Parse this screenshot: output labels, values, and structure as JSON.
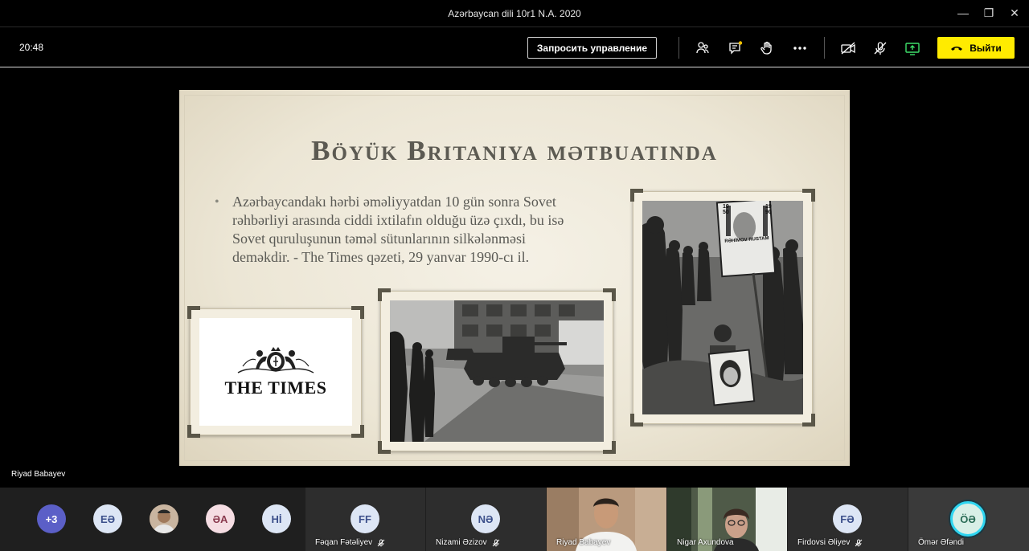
{
  "window": {
    "title": "Azərbaycan dili 10r1 N.A. 2020",
    "minimize_glyph": "—",
    "maximize_glyph": "❐",
    "close_glyph": "✕"
  },
  "toolbar": {
    "clock": "20:48",
    "request_control_label": "Запросить управление",
    "leave_label": "Выйти",
    "icons": [
      "participants-icon",
      "chat-icon",
      "raise-hand-icon",
      "more-icon",
      "camera-off-icon",
      "mic-off-icon",
      "share-tray-icon",
      "hang-up-icon"
    ],
    "colors": {
      "leave_bg": "#ffeb00",
      "chat_badge": "#f3c300",
      "share_icon": "#3ee06a"
    }
  },
  "slide": {
    "title": "Böyük Britaniya mətbuatında",
    "bullet": "Azərbaycandakı hərbi əməliyyatdan 10 gün sonra Sovet rəhbərliyi arasında ciddi ixtilafın olduğu üzə çıxdı, bu isə Sovet quruluşunun təməl sütunlarının silkələnməsi deməkdir.  - The Times qəzeti, 29 yanvar 1990-cı il.",
    "times_logo_text": "THE TIMES",
    "poster_text": {
      "year_left": "1950",
      "year_right": "1990",
      "name": "RƏHİMOV RUSTAM"
    }
  },
  "presenter_label": "Riyad Babayev",
  "participants": {
    "overflow_count": "+3",
    "avatars": [
      {
        "initials": "EƏ",
        "bg": "#dde6f5",
        "fg": "#3b4f8a"
      },
      {
        "initials": "ƏA",
        "bg": "#f5dde3",
        "fg": "#8a3b4f"
      },
      {
        "initials": "Hİ",
        "bg": "#dde6f5",
        "fg": "#3b4f8a"
      }
    ],
    "tiles": [
      {
        "name": "Fəqan Fətəliyev",
        "initials": "FF"
      },
      {
        "name": "Nizami Əzizov",
        "initials": "NƏ"
      },
      {
        "name": "Riyad Babayev",
        "initials": ""
      },
      {
        "name": "Nigar Axundova",
        "initials": ""
      },
      {
        "name": "Firdovsi Əliyev",
        "initials": "FƏ"
      },
      {
        "name": "Ömər Əfəndi",
        "initials": "ÖƏ"
      }
    ]
  }
}
